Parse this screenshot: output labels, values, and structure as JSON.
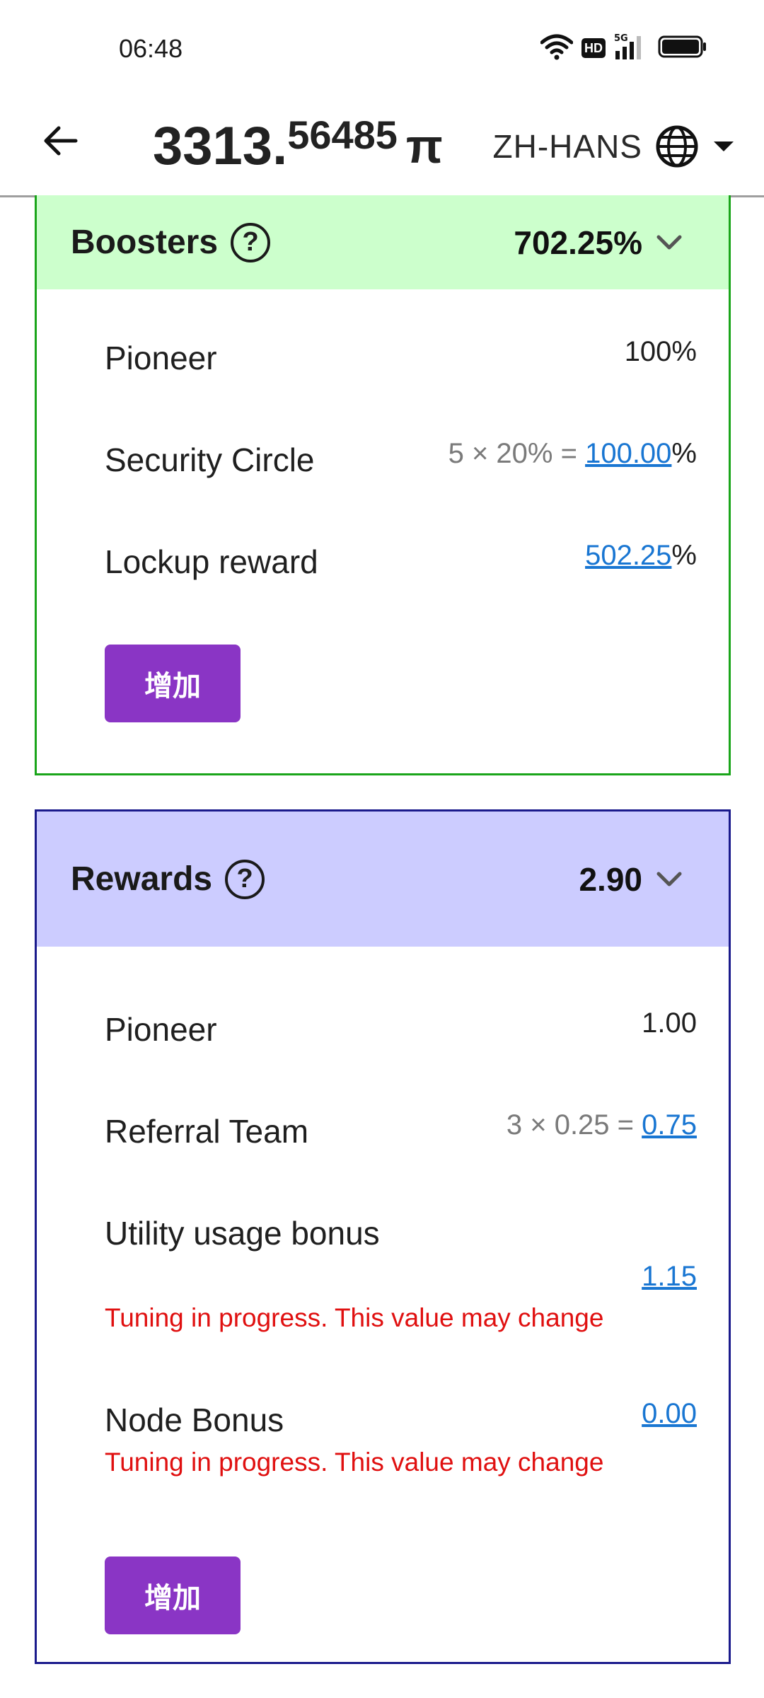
{
  "status_bar": {
    "time": "06:48",
    "icons": [
      "wifi-icon",
      "hd-icon",
      "5g-signal-icon",
      "battery-icon"
    ],
    "hd_label": "HD"
  },
  "header": {
    "balance_int": "3313.",
    "balance_frac": "56485",
    "currency_symbol": "π",
    "language": "ZH-HANS"
  },
  "boosters": {
    "title": "Boosters",
    "help_symbol": "?",
    "total": "702.25%",
    "rows": [
      {
        "label": "Pioneer",
        "value": "100%"
      },
      {
        "label": "Security Circle",
        "formula": "5 × 20% = ",
        "link": "100.00",
        "suffix": "%"
      },
      {
        "label": "Lockup reward",
        "link": "502.25",
        "suffix": "%"
      }
    ],
    "button_label": "增加"
  },
  "rewards": {
    "title": "Rewards",
    "help_symbol": "?",
    "total": "2.90",
    "rows": [
      {
        "label": "Pioneer",
        "value": "1.00"
      },
      {
        "label": "Referral Team",
        "formula": "3 × 0.25 = ",
        "link": "0.75"
      },
      {
        "label": "Utility usage bonus",
        "link": "1.15",
        "warning": "Tuning in progress. This value may change"
      },
      {
        "label": "Node Bonus",
        "link": "0.00",
        "warning": "Tuning in progress. This value may change"
      }
    ],
    "button_label": "增加"
  },
  "colors": {
    "boosters_header": "#ccffcc",
    "boosters_border": "#1aa51a",
    "rewards_header": "#ccccff",
    "rewards_border": "#1a1a8c",
    "button": "#8a35c5",
    "link": "#1976d2",
    "warning": "#e01010"
  }
}
